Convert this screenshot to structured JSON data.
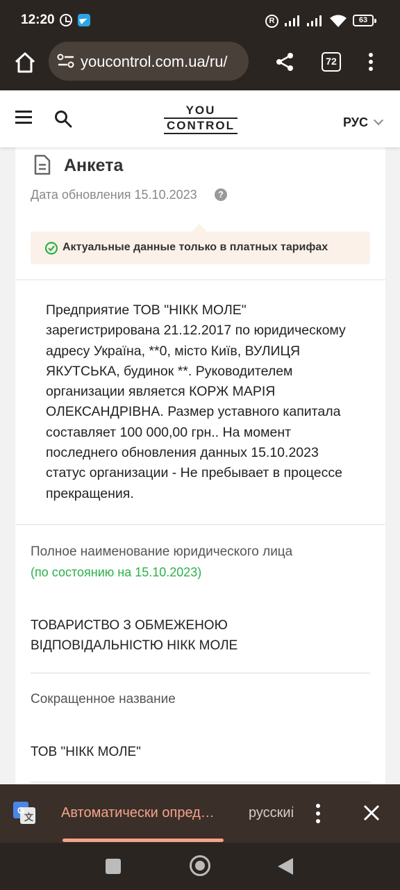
{
  "status_bar": {
    "time": "12:20",
    "battery": "63",
    "icons": [
      "alarm-icon",
      "telegram-icon",
      "r-icon",
      "signal-icon",
      "signal-icon",
      "wifi-icon",
      "battery-icon"
    ]
  },
  "browser": {
    "url": "youcontrol.com.ua/ru/",
    "tab_count": "72",
    "icons": [
      "home-icon",
      "site-settings-icon",
      "share-icon",
      "more-vert-icon"
    ]
  },
  "site_header": {
    "logo_line1": "YOU",
    "logo_line2": "CONTROL",
    "language": "РУС"
  },
  "card": {
    "title": "Анкета",
    "update_date": "Дата обновления 15.10.2023",
    "help": "?",
    "notice": "Актуальные данные только в платных тарифах",
    "summary": "Предприятие ТОВ \"НІКК МОЛЕ\" зарегистрирована 21.12.2017 по юридическому адресу Україна, **0, місто Київ, ВУЛИЦЯ ЯКУТСЬКА, будинок **. Руководителем организации является КОРЖ МАРІЯ ОЛЕКСАНДРІВНА. Размер уставного капитала составляет 100 000,00 грн.. На момент последнего обновления данных 15.10.2023 статус организации - Не пребывает в процессе прекращения.",
    "full_name_label": "Полное наименование юридического лица",
    "full_name_sub": "(по состоянию на 15.10.2023)",
    "full_name_value": "ТОВАРИСТВО З ОБМЕЖЕНОЮ ВІДПОВІДАЛЬНІСТЮ НІКК МОЛЕ",
    "short_name_label": "Сокращенное название",
    "short_name_value": "ТОВ \"НІКК МОЛЕ\""
  },
  "translate_bar": {
    "detect_label": "Автоматически опред…",
    "language_label": "русский"
  },
  "colors": {
    "accent_green": "#2bb14a",
    "notice_bg": "#fbf1e8",
    "translate_accent": "#f4a48a",
    "chrome_dark": "#2b2521"
  }
}
